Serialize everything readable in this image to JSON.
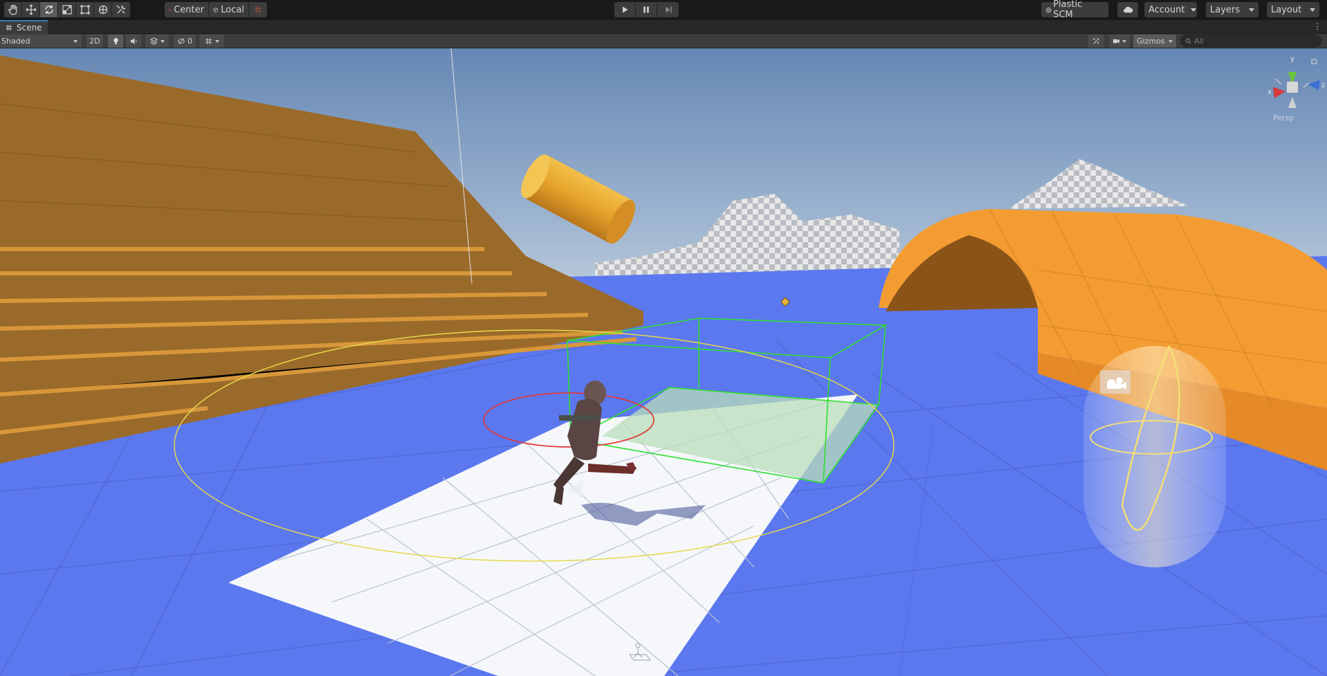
{
  "toolbar": {
    "pivot_label": "Center",
    "space_label": "Local",
    "vcs_label": "Plastic SCM",
    "account_label": "Account",
    "layers_label": "Layers",
    "layout_label": "Layout"
  },
  "tab": {
    "title": "Scene"
  },
  "scene_bar": {
    "shading_mode": "Shaded",
    "mode_2d": "2D",
    "hidden_count": "0",
    "gizmos_label": "Gizmos",
    "search_placeholder": "All"
  },
  "orientation_gizmo": {
    "y": "y",
    "x": "x",
    "z": "z",
    "projection_label": "Persp"
  },
  "colors": {
    "sky_top": "#6f8fb7",
    "ground_blue": "#5c79f0",
    "orange": "#f5a03b",
    "selection_green": "#2ee02e",
    "gizmo_yellow": "#e6d84a"
  }
}
